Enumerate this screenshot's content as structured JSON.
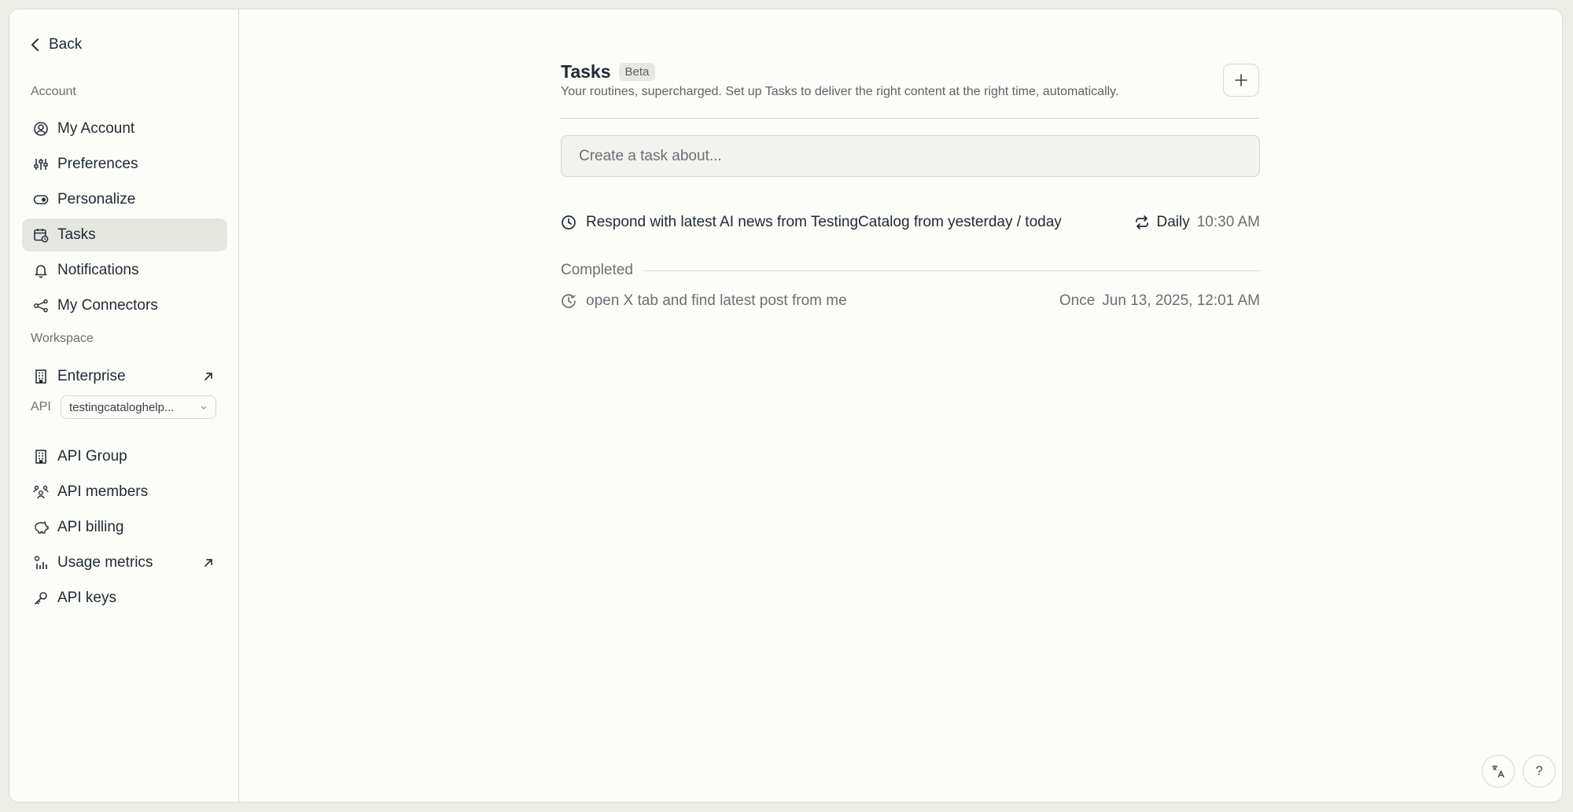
{
  "sidebar": {
    "back_label": "Back",
    "account_label": "Account",
    "account_items": [
      {
        "label": "My Account",
        "icon": "user-circle-icon"
      },
      {
        "label": "Preferences",
        "icon": "sliders-icon"
      },
      {
        "label": "Personalize",
        "icon": "toggle-icon"
      },
      {
        "label": "Tasks",
        "icon": "calendar-clock-icon",
        "active": true
      },
      {
        "label": "Notifications",
        "icon": "bell-icon"
      },
      {
        "label": "My Connectors",
        "icon": "connectors-icon"
      }
    ],
    "workspace_label": "Workspace",
    "workspace_items": [
      {
        "label": "Enterprise",
        "icon": "building-icon",
        "external": true
      }
    ],
    "api_label": "API",
    "api_select_value": "testingcataloghelp...",
    "api_items": [
      {
        "label": "API Group",
        "icon": "building-icon"
      },
      {
        "label": "API members",
        "icon": "members-icon"
      },
      {
        "label": "API billing",
        "icon": "piggy-bank-icon"
      },
      {
        "label": "Usage metrics",
        "icon": "chart-icon",
        "external": true
      },
      {
        "label": "API keys",
        "icon": "key-icon"
      }
    ]
  },
  "main": {
    "title": "Tasks",
    "badge": "Beta",
    "subtitle": "Your routines, supercharged. Set up Tasks to deliver the right content at the right time, automatically.",
    "input_placeholder": "Create a task about...",
    "active_task": {
      "name": "Respond with latest AI news from TestingCatalog from yesterday / today",
      "frequency": "Daily",
      "time": "10:30 AM"
    },
    "completed_label": "Completed",
    "completed_task": {
      "name": "open X tab and find latest post from me",
      "frequency": "Once",
      "time": "Jun 13, 2025, 12:01 AM"
    }
  },
  "footer": {
    "help_label": "?"
  },
  "colors": {
    "background": "#fcfcf8",
    "active_item": "#e6e6e1",
    "text": "#1f2a33",
    "muted": "#6b7075"
  }
}
